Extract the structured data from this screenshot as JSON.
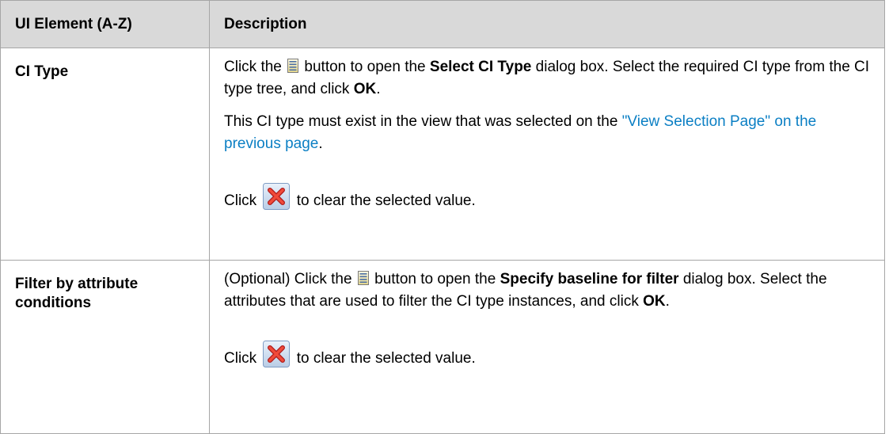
{
  "table": {
    "headers": [
      "UI Element (A-Z)",
      "Description"
    ],
    "rows": [
      {
        "element": "CI Type",
        "p1": {
          "pre": "Click the",
          "post": "button to open the",
          "bold1": "Select CI Type",
          "mid": "dialog box. Select the required CI type from the CI type tree, and click",
          "bold2": "OK",
          "end": "."
        },
        "p2": {
          "pre": "This CI type must exist in the view that was selected on the",
          "link": "\"View Selection Page\" on the previous page",
          "end": "."
        },
        "p3": {
          "pre": "Click",
          "post": "to clear the selected value."
        }
      },
      {
        "element": "Filter by attribute conditions",
        "p1": {
          "pre": "(Optional) Click the",
          "post": "button to open the",
          "bold1": "Specify baseline for filter",
          "mid": "dialog box. Select the attributes that are used to filter the CI type instances, and click",
          "bold2": "OK",
          "end": "."
        },
        "p3": {
          "pre": "Click",
          "post": "to clear the selected value."
        }
      }
    ]
  },
  "icons": {
    "list_button": "list-icon",
    "clear_button": "clear-icon"
  },
  "colors": {
    "header_bg": "#d9d9d9",
    "link": "#0b7fc4",
    "border": "#a6a6a6"
  }
}
